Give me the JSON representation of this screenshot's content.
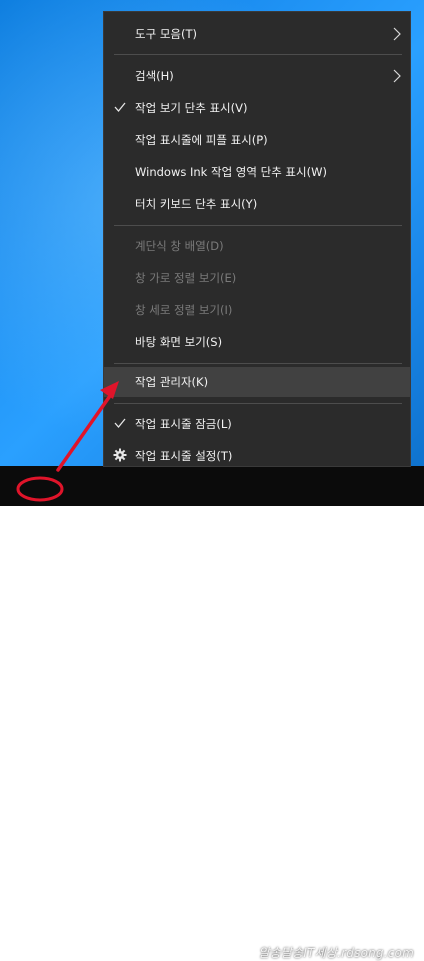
{
  "menu": {
    "items": [
      {
        "label": "도구 모음(T)",
        "submenu": true
      },
      {
        "label": "검색(H)",
        "submenu": true
      },
      {
        "label": "작업 보기 단추 표시(V)",
        "checked": true
      },
      {
        "label": "작업 표시줄에 피플 표시(P)"
      },
      {
        "label": "Windows Ink 작업 영역 단추 표시(W)"
      },
      {
        "label": "터치 키보드 단추 표시(Y)"
      },
      {
        "label": "계단식 창 배열(D)",
        "disabled": true
      },
      {
        "label": "창 가로 정렬 보기(E)",
        "disabled": true
      },
      {
        "label": "창 세로 정렬 보기(I)",
        "disabled": true
      },
      {
        "label": "바탕 화면 보기(S)"
      },
      {
        "label": "작업 관리자(K)",
        "highlighted": true
      },
      {
        "label": "작업 표시줄 잠금(L)",
        "checked": true
      },
      {
        "label": "작업 표시줄 설정(T)",
        "icon": "gear-icon"
      }
    ]
  },
  "watermark": "알송달송IT세상.rdsong.com",
  "colors": {
    "menu_bg": "#2b2b2b",
    "highlight_bg": "#414141",
    "text": "#f2f2f2",
    "disabled_text": "#7a7a7a",
    "annotation_red": "#e0142a",
    "taskbar": "#0b0b0b"
  }
}
